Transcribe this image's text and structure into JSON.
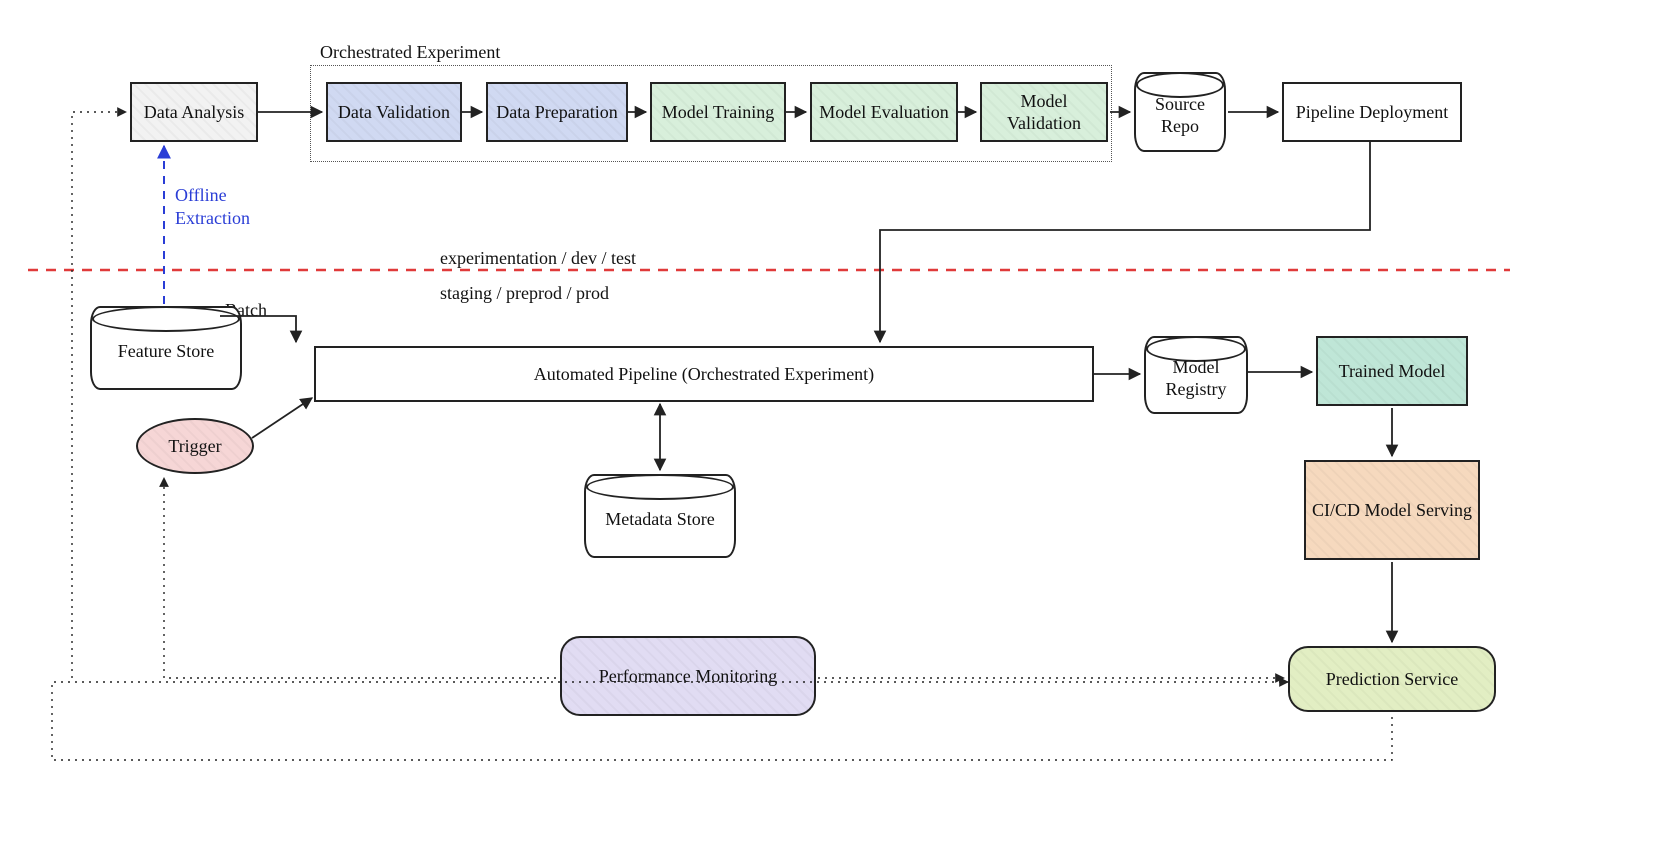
{
  "orchestrated_label": "Orchestrated Experiment",
  "env_top": "experimentation / dev / test",
  "env_bottom": "staging / preprod / prod",
  "batch_label": "Batch",
  "offline_label_1": "Offline",
  "offline_label_2": "Extraction",
  "nodes": {
    "data_analysis": "Data Analysis",
    "data_validation": "Data Validation",
    "data_prep": "Data Preparation",
    "model_training": "Model Training",
    "model_eval": "Model Evaluation",
    "model_valid": "Model Validation",
    "source_repo": "Source Repo",
    "pipeline_deploy": "Pipeline Deployment",
    "feature_store": "Feature Store",
    "trigger": "Trigger",
    "auto_pipeline": "Automated Pipeline (Orchestrated Experiment)",
    "model_registry": "Model Registry",
    "trained_model": "Trained Model",
    "cicd": "CI/CD Model Serving",
    "prediction_service": "Prediction Service",
    "metadata_store": "Metadata Store",
    "perf_monitor": "Performance Monitoring"
  },
  "colors": {
    "orange_blob": "#f4a63a",
    "cyan_blob": "#33c6ee",
    "green_blob": "#45d86c",
    "pink_blob": "#e8317a",
    "red_dash": "#e03a3a",
    "blue": "#2a3dd6"
  }
}
